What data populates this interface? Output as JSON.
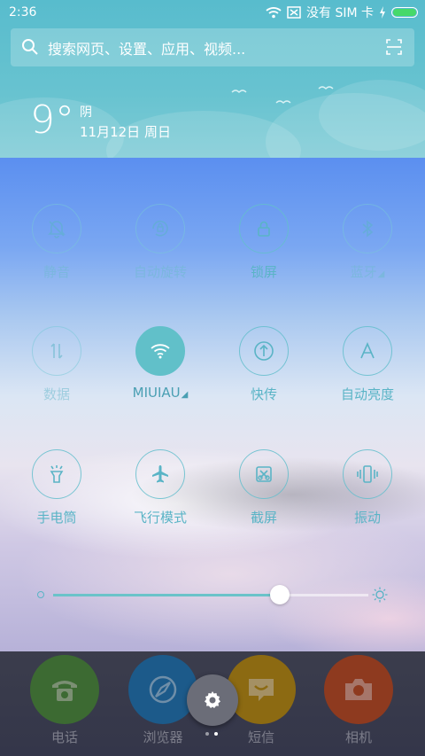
{
  "status_bar": {
    "time": "2:36",
    "carrier": "没有 SIM 卡",
    "icons": [
      "wifi-icon",
      "sim-icon",
      "charging-icon",
      "battery-icon"
    ],
    "battery_color": "#46d96a"
  },
  "search": {
    "placeholder": "搜索网页、设置、应用、视频...",
    "icons": [
      "search-icon",
      "scan-icon"
    ]
  },
  "weather": {
    "temperature": "9°",
    "condition": "阴",
    "date": "11月12日 周日"
  },
  "toggles": [
    {
      "label": "静音",
      "icon": "bell-mute-icon",
      "active": false,
      "dim": true
    },
    {
      "label": "自动旋转",
      "icon": "rotate-icon",
      "active": false,
      "dim": true
    },
    {
      "label": "锁屏",
      "icon": "lock-icon",
      "active": false,
      "dim": false
    },
    {
      "label": "蓝牙",
      "icon": "bluetooth-icon",
      "active": false,
      "dim": true
    },
    {
      "label": "数据",
      "icon": "data-icon",
      "active": false,
      "dim": true
    },
    {
      "label": "MIUIAU",
      "icon": "wifi-icon",
      "active": true,
      "dim": false
    },
    {
      "label": "快传",
      "icon": "transfer-icon",
      "active": false,
      "dim": false
    },
    {
      "label": "自动亮度",
      "icon": "auto-brightness-icon",
      "active": false,
      "dim": false
    },
    {
      "label": "手电筒",
      "icon": "flashlight-icon",
      "active": false,
      "dim": false
    },
    {
      "label": "飞行模式",
      "icon": "airplane-icon",
      "active": false,
      "dim": false
    },
    {
      "label": "截屏",
      "icon": "screenshot-icon",
      "active": false,
      "dim": false
    },
    {
      "label": "振动",
      "icon": "vibrate-icon",
      "active": false,
      "dim": false
    }
  ],
  "brightness": {
    "level": 0.72,
    "accent": "#6ac3c9"
  },
  "dock": [
    {
      "label": "电话",
      "icon": "phone-icon",
      "color": "#3c6a32"
    },
    {
      "label": "浏览器",
      "icon": "compass-icon",
      "color": "#1c5a8a"
    },
    {
      "label": "短信",
      "icon": "message-icon",
      "color": "#8c6a12"
    },
    {
      "label": "相机",
      "icon": "camera-icon",
      "color": "#8e3a1f"
    }
  ],
  "settings_button": {
    "icon": "gear-icon"
  },
  "page_indicator": {
    "count": 2,
    "current": 2
  }
}
